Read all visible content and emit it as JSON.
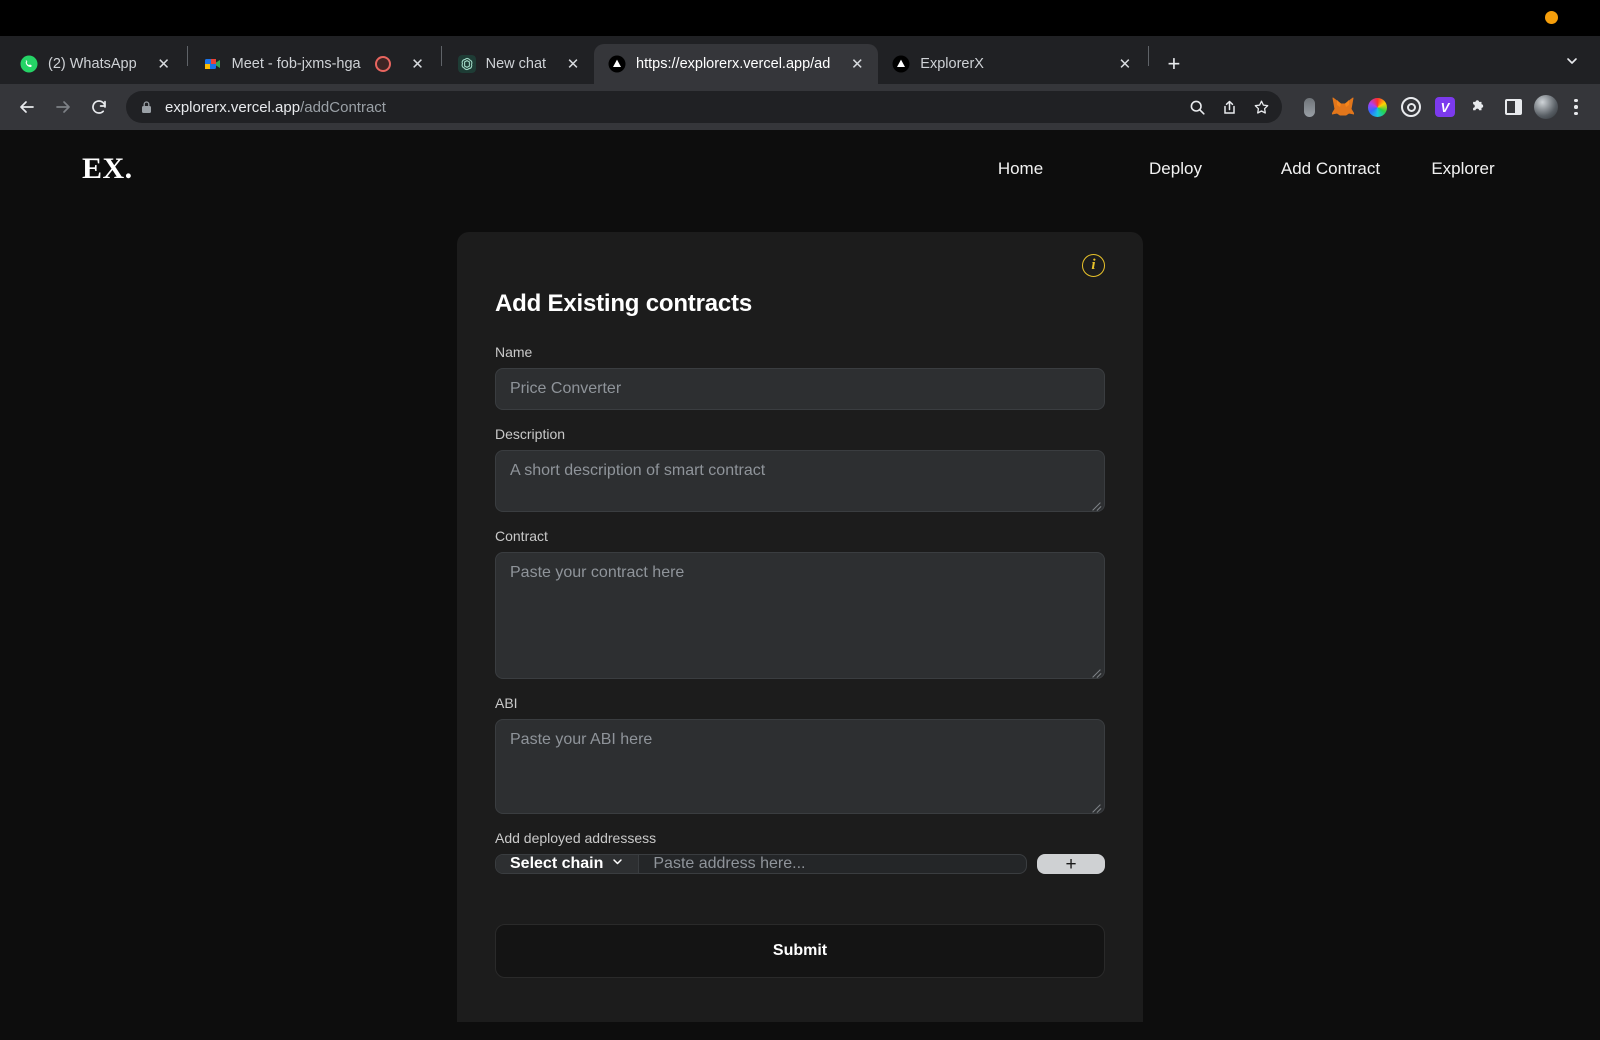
{
  "browser": {
    "tabs": [
      {
        "label": "(2) WhatsApp",
        "favicon": "whatsapp-icon",
        "active": false
      },
      {
        "label": "Meet - fob-jxms-hga",
        "favicon": "google-meet-icon",
        "active": false
      },
      {
        "label": "New chat",
        "favicon": "chatgpt-icon",
        "active": false
      },
      {
        "label": "https://explorerx.vercel.app/ad",
        "favicon": "vercel-icon",
        "active": true
      },
      {
        "label": "ExplorerX",
        "favicon": "vercel-icon",
        "active": false
      }
    ],
    "close_label": "✕",
    "new_tab_label": "+",
    "tab_search_icon": "chevron-down-icon",
    "recording_indicator": "record-dot-icon",
    "url": {
      "host": "explorerx.vercel.app",
      "path": "/addContract",
      "secure_icon": "lock-icon"
    },
    "toolbar_icons": [
      "back-icon",
      "forward-icon",
      "reload-icon",
      "search-icon",
      "share-icon",
      "bookmark-star-icon",
      "extension-pill-icon",
      "metamask-icon",
      "color-wheel-icon",
      "target-icon",
      "vercel-ext-icon",
      "puzzle-icon",
      "side-panel-icon",
      "profile-avatar",
      "menu-icon"
    ],
    "os_indicator": "orange-status-dot"
  },
  "site": {
    "logo": "EX.",
    "nav": [
      {
        "label": "Home"
      },
      {
        "label": "Deploy"
      },
      {
        "label": "Add Contract"
      },
      {
        "label": "Explorer"
      }
    ]
  },
  "card": {
    "info_icon": "info-icon",
    "info_glyph": "i",
    "title": "Add Existing contracts",
    "fields": {
      "name": {
        "label": "Name",
        "value": "",
        "placeholder": "Price Converter"
      },
      "description": {
        "label": "Description",
        "value": "",
        "placeholder": "A short description of smart contract"
      },
      "contract": {
        "label": "Contract",
        "value": "",
        "placeholder": "Paste your contract here"
      },
      "abi": {
        "label": "ABI",
        "value": "",
        "placeholder": "Paste your ABI here"
      },
      "addresses": {
        "label": "Add deployed addressess",
        "chain_selected": "Select chain",
        "chain_chevron": "chevron-down-icon",
        "address_value": "",
        "address_placeholder": "Paste address here...",
        "add_label": "+"
      }
    },
    "submit_label": "Submit"
  },
  "colors": {
    "page_bg": "#0d0d0d",
    "card_bg": "#1c1c1c",
    "input_bg": "#2d2f31",
    "accent_info": "#e8c22a",
    "add_button": "#cfd1d3",
    "status_dot": "#f59e0b"
  }
}
